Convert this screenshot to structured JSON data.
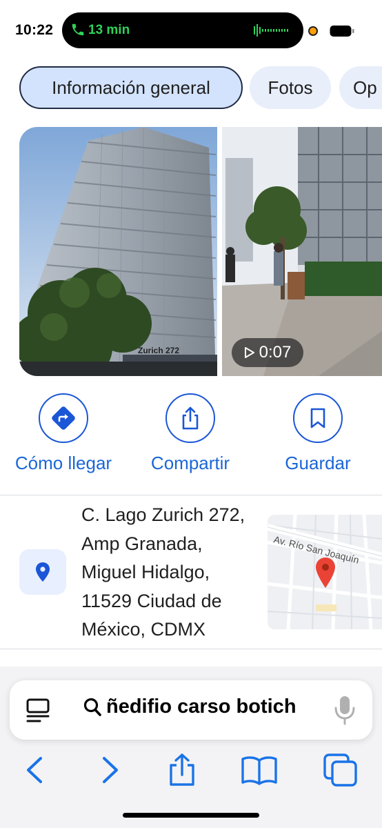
{
  "status_bar": {
    "time": "10:22",
    "call_duration": "13 min",
    "call_color": "#30d158"
  },
  "tabs": [
    {
      "label": "Información general",
      "active": true
    },
    {
      "label": "Fotos",
      "active": false
    },
    {
      "label": "Op",
      "active": false
    }
  ],
  "photos": {
    "video_duration": "0:07",
    "building_sign": "Zurich 272"
  },
  "actions": [
    {
      "label": "Cómo llegar",
      "icon": "directions-icon"
    },
    {
      "label": "Compartir",
      "icon": "share-icon"
    },
    {
      "label": "Guardar",
      "icon": "bookmark-icon"
    }
  ],
  "place": {
    "address": "C. Lago Zurich 272, Amp Granada, Miguel Hidalgo, 11529 Ciudad de México, CDMX",
    "map_street_label": "Av. Río San Joaquín"
  },
  "browser": {
    "search_text": "ñedifio carso botich",
    "accent_color": "#1a73e8"
  },
  "colors": {
    "accent": "#1a66d6",
    "tab_active_bg": "#d3e3fd",
    "map_pin": "#ea4335"
  }
}
